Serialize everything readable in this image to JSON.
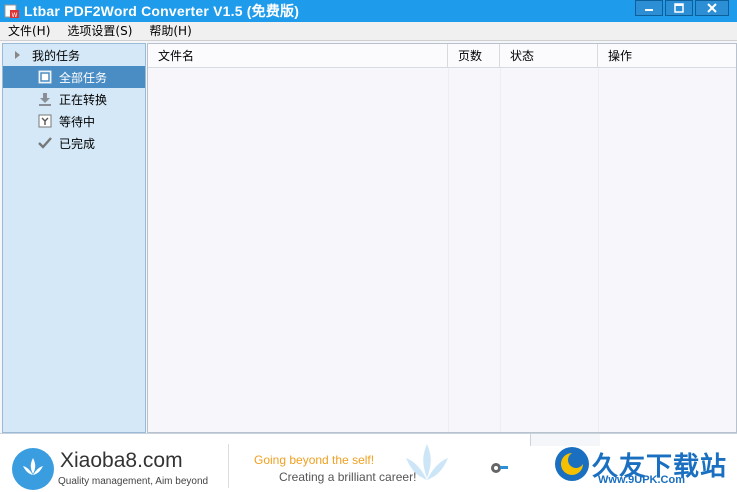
{
  "window": {
    "title": "Ltbar PDF2Word Converter V1.5 (免费版)",
    "controls": [
      "minimize",
      "maximize",
      "close"
    ]
  },
  "menubar": {
    "items": [
      {
        "label": "文件(H)"
      },
      {
        "label": "选项设置(S)"
      },
      {
        "label": "帮助(H)"
      }
    ]
  },
  "sidebar": {
    "root_label": "我的任务",
    "items": [
      {
        "label": "全部任务",
        "icon": "all-tasks-icon",
        "active": true
      },
      {
        "label": "正在转换",
        "icon": "download-icon",
        "active": false
      },
      {
        "label": "等待中",
        "icon": "waiting-icon",
        "active": false
      },
      {
        "label": "已完成",
        "icon": "checkmark-icon",
        "active": false
      }
    ]
  },
  "table": {
    "columns": [
      "文件名",
      "页数",
      "状态",
      "操作"
    ],
    "rows": []
  },
  "footer": {
    "brand": "Xiaoba8.com",
    "brand_tagline": "Quality management, Aim beyond",
    "slogan_line1": "Going beyond the self!",
    "slogan_line2": "Creating a brilliant career!",
    "watermark_text": "久友下载站",
    "watermark_url": "Www.9UPK.Com"
  },
  "colors": {
    "titlebar": "#1e9bea",
    "sidebar_bg": "#d5e8f7",
    "sidebar_active": "#4a8cc4",
    "slogan_accent": "#f0a020"
  }
}
